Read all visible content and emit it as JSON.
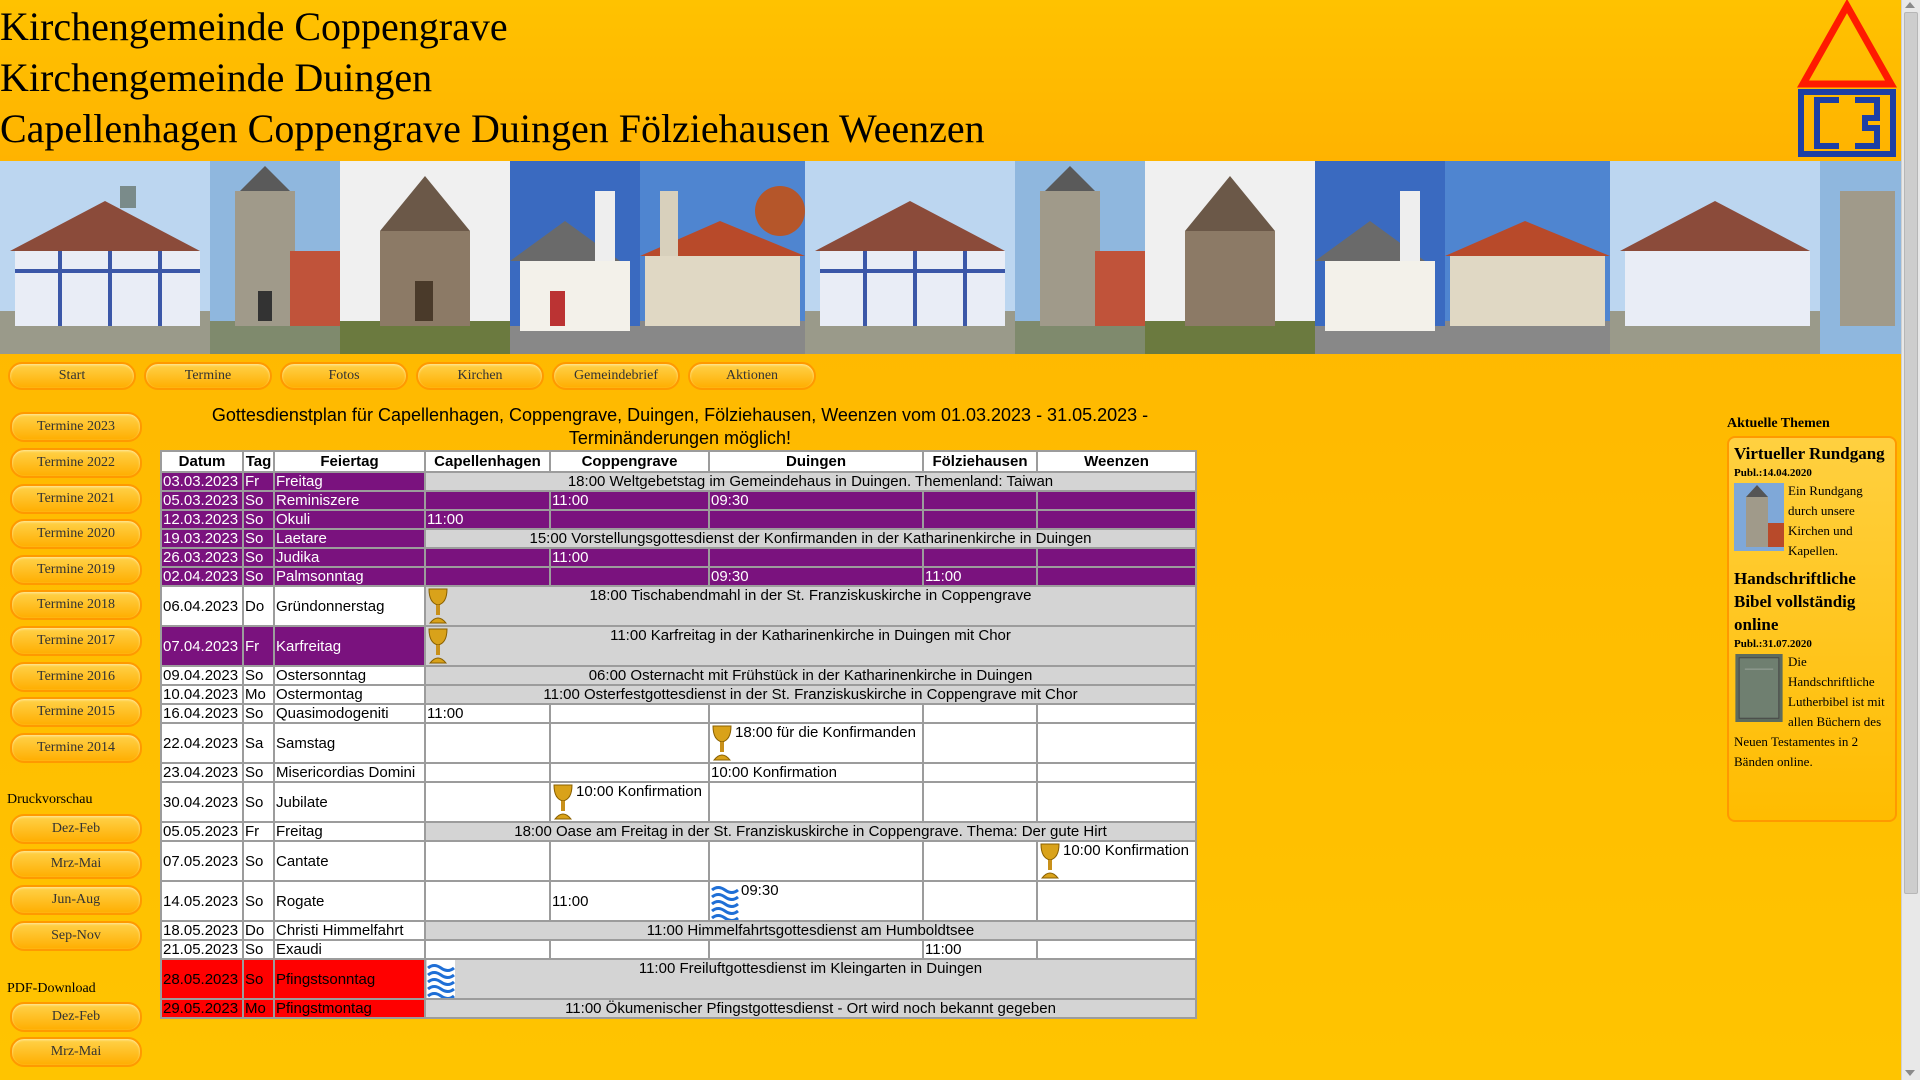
{
  "header": {
    "title_lines": [
      "Kirchengemeinde Coppengrave",
      "Kirchengemeinde Duingen",
      "Capellenhagen Coppengrave Duingen Fölziehausen Weenzen"
    ]
  },
  "nav": {
    "items": [
      "Start",
      "Termine",
      "Fotos",
      "Kirchen",
      "Gemeindebrief",
      "Aktionen"
    ]
  },
  "sidebar": {
    "termine": [
      "Termine 2023",
      "Termine 2022",
      "Termine 2021",
      "Termine 2020",
      "Termine 2019",
      "Termine 2018",
      "Termine 2017",
      "Termine 2016",
      "Termine 2015",
      "Termine 2014"
    ],
    "druck_heading": "Druckvorschau",
    "druck": [
      "Dez-Feb",
      "Mrz-Mai",
      "Jun-Aug",
      "Sep-Nov"
    ],
    "pdf_heading": "PDF-Download",
    "pdf": [
      "Dez-Feb",
      "Mrz-Mai"
    ]
  },
  "content": {
    "title_line1": "Gottesdienstplan für Capellenhagen, Coppengrave, Duingen, Fölziehausen, Weenzen vom 01.03.2023 - 31.05.2023 -",
    "title_line2": "Terminänderungen möglich!",
    "columns": [
      "Datum",
      "Tag",
      "Feiertag",
      "Capellenhagen",
      "Coppengrave",
      "Duingen",
      "Fölziehausen",
      "Weenzen"
    ],
    "rows": [
      {
        "date": "03.03.2023",
        "day": "Fr",
        "feast": "Freitag",
        "wide": "18:00 Weltgebetstag im Gemeindehaus in Duingen. Themenland: Taiwan"
      },
      {
        "date": "05.03.2023",
        "day": "So",
        "feast": "Reminiszere",
        "cop": "11:00",
        "dui": "09:30"
      },
      {
        "date": "12.03.2023",
        "day": "So",
        "feast": "Okuli",
        "cap": "11:00"
      },
      {
        "date": "19.03.2023",
        "day": "So",
        "feast": "Laetare",
        "wide": "15:00 Vorstellungsgottesdienst der Konfirmanden in der Katharinenkirche in Duingen"
      },
      {
        "date": "26.03.2023",
        "day": "So",
        "feast": "Judika",
        "cop": "11:00"
      },
      {
        "date": "02.04.2023",
        "day": "So",
        "feast": "Palmsonntag",
        "dui": "09:30",
        "fol": "11:00"
      },
      {
        "date": "06.04.2023",
        "day": "Do",
        "feast": "Gründonnerstag",
        "wide": "18:00 Tischabendmahl in der St. Franziskuskirche in Coppengrave"
      },
      {
        "date": "07.04.2023",
        "day": "Fr",
        "feast": "Karfreitag",
        "wide": "11:00 Karfreitag in der Katharinenkirche in Duingen mit Chor"
      },
      {
        "date": "09.04.2023",
        "day": "So",
        "feast": "Ostersonntag",
        "wide": "06:00 Osternacht mit Frühstück in der Katharinenkirche in Duingen"
      },
      {
        "date": "10.04.2023",
        "day": "Mo",
        "feast": "Ostermontag",
        "wide": "11:00 Osterfestgottesdienst in der St. Franziskuskirche in Coppengrave mit Chor"
      },
      {
        "date": "16.04.2023",
        "day": "So",
        "feast": "Quasimodogeniti",
        "cap": "11:00"
      },
      {
        "date": "22.04.2023",
        "day": "Sa",
        "feast": "Samstag",
        "dui": "18:00 für die Konfirmanden"
      },
      {
        "date": "23.04.2023",
        "day": "So",
        "feast": "Misericordias Domini",
        "dui": "10:00 Konfirmation"
      },
      {
        "date": "30.04.2023",
        "day": "So",
        "feast": "Jubilate",
        "cop": "10:00 Konfirmation"
      },
      {
        "date": "05.05.2023",
        "day": "Fr",
        "feast": "Freitag",
        "wide": "18:00 Oase am Freitag in der St. Franziskuskirche in Coppengrave. Thema: Der gute Hirt"
      },
      {
        "date": "07.05.2023",
        "day": "So",
        "feast": "Cantate",
        "wee": "10:00 Konfirmation"
      },
      {
        "date": "14.05.2023",
        "day": "So",
        "feast": "Rogate",
        "cop": "11:00",
        "dui": "09:30"
      },
      {
        "date": "18.05.2023",
        "day": "Do",
        "feast": "Christi Himmelfahrt",
        "wide": "11:00 Himmelfahrtsgottesdienst am Humboldtsee"
      },
      {
        "date": "21.05.2023",
        "day": "So",
        "feast": "Exaudi",
        "fol": "11:00"
      },
      {
        "date": "28.05.2023",
        "day": "So",
        "feast": "Pfingstsonntag",
        "wide": "11:00 Freiluftgottesdienst im Kleingarten in Duingen"
      },
      {
        "date": "29.05.2023",
        "day": "Mo",
        "feast": "Pfingstmontag",
        "wide": "11:00 Ökumenischer Pfingstgottesdienst - Ort wird noch bekannt gegeben"
      }
    ]
  },
  "rightpanel": {
    "heading": "Aktuelle Themen",
    "articles": [
      {
        "title": "Virtueller Rundgang",
        "date": "Publ.:14.04.2020",
        "text": "Ein Rundgang durch unsere Kirchen und Kapellen."
      },
      {
        "title": "Handschriftliche Bibel vollständig online",
        "date": "Publ.:31.07.2020",
        "text": "Die Handschriftliche Lutherbibel ist mit allen Büchern des Neuen Testamentes in 2 Bänden online."
      }
    ]
  },
  "colors": {
    "purple": "#7a127e",
    "red": "#ff0000",
    "orange": "#ffb400",
    "gray": "#d4d4d4"
  },
  "icons": {
    "chalice": "chalice-icon",
    "baptism": "water-waves-icon"
  }
}
